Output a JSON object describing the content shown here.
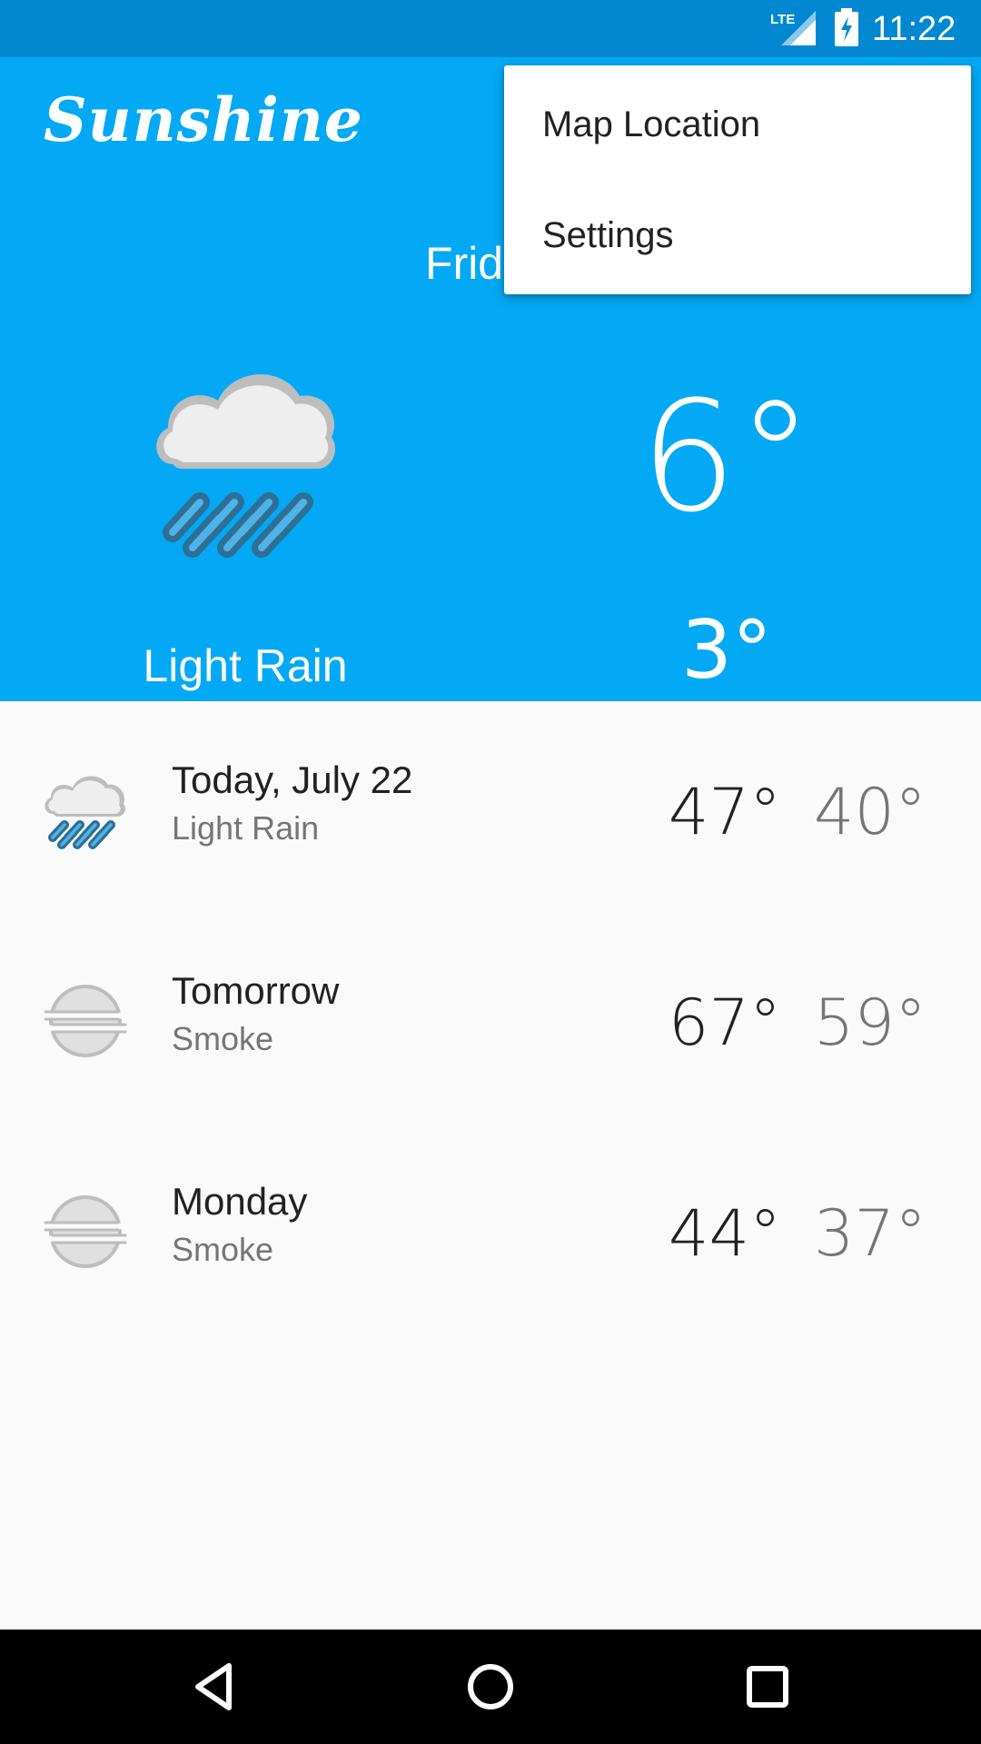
{
  "status_bar": {
    "time": "11:22",
    "network_label": "LTE",
    "icons": [
      "lte-signal-icon",
      "battery-charging-icon"
    ]
  },
  "app": {
    "title": "Sunshine"
  },
  "today": {
    "date": "Frid",
    "description": "Light Rain",
    "high": "6°",
    "low": "3°",
    "icon": "light-rain-icon"
  },
  "overflow_menu": {
    "items": [
      {
        "label": "Map Location"
      },
      {
        "label": "Settings"
      }
    ]
  },
  "forecast": [
    {
      "day": "Today, July 22",
      "description": "Light Rain",
      "high": "47°",
      "low": "40°",
      "icon": "light-rain-icon"
    },
    {
      "day": "Tomorrow",
      "description": "Smoke",
      "high": "67°",
      "low": "59°",
      "icon": "fog-icon"
    },
    {
      "day": "Monday",
      "description": "Smoke",
      "high": "44°",
      "low": "37°",
      "icon": "fog-icon"
    }
  ],
  "navigation": {
    "buttons": [
      "back-icon",
      "home-icon",
      "recents-icon"
    ]
  },
  "colors": {
    "primary": "#03a9f4",
    "primary_dark": "#0288d1",
    "background": "#fafafa",
    "text_primary": "#212121",
    "text_secondary": "#757575"
  }
}
